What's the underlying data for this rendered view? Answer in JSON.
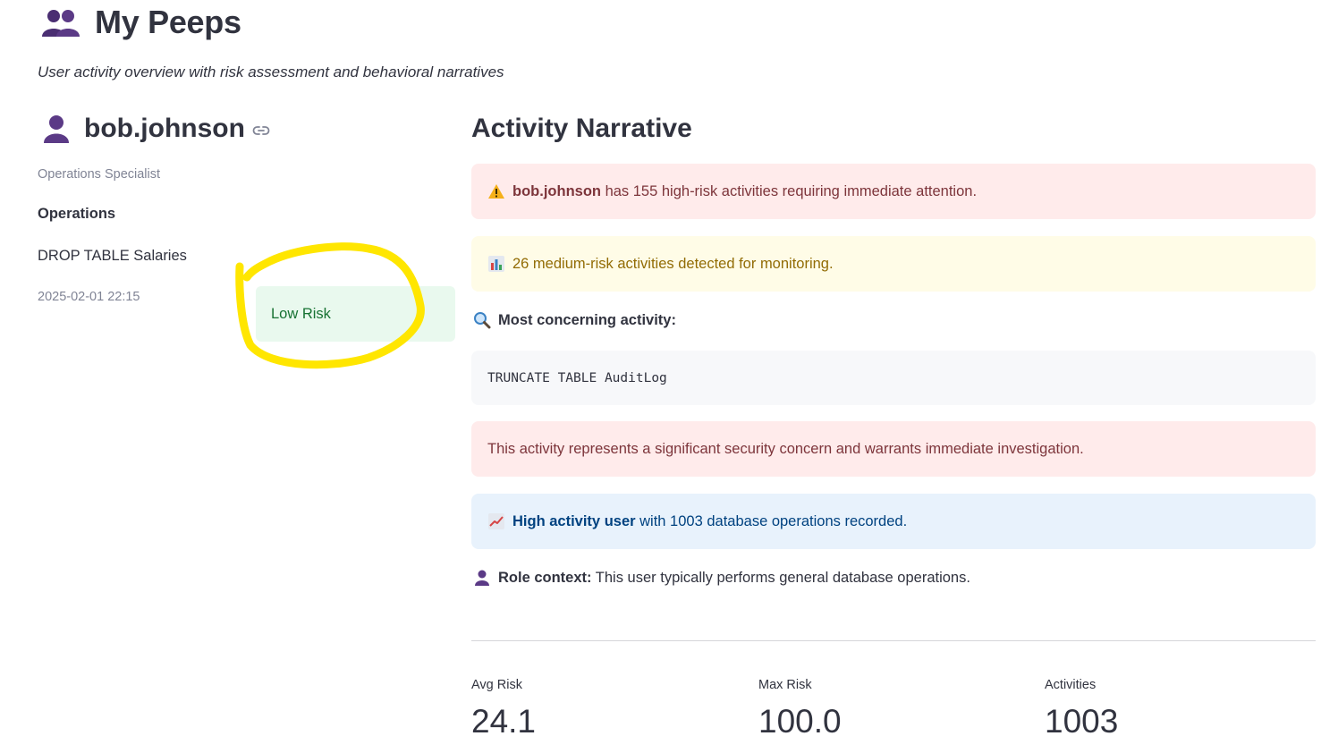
{
  "header": {
    "title": "My Peeps",
    "subtitle": "User activity overview with risk assessment and behavioral narratives",
    "icon": "busts-in-silhouette-icon"
  },
  "user": {
    "name": "bob.johnson",
    "role": "Operations Specialist",
    "department": "Operations",
    "activity": "DROP TABLE Salaries",
    "timestamp": "2025-02-01 22:15",
    "risk_badge": "Low Risk"
  },
  "narrative": {
    "title": "Activity Narrative",
    "high_risk_user": "bob.johnson",
    "high_risk_text": " has 155 high-risk activities requiring immediate attention.",
    "medium_risk_text": "26 medium-risk activities detected for monitoring.",
    "most_concerning_label": "Most concerning activity:",
    "most_concerning_query": "TRUNCATE TABLE AuditLog",
    "concern_text": "This activity represents a significant security concern and warrants immediate investigation.",
    "activity_level_bold": "High activity user",
    "activity_level_text": " with 1003 database operations recorded.",
    "role_context_label": "Role context:",
    "role_context_text": " This user typically performs general database operations."
  },
  "metrics": [
    {
      "label": "Avg Risk",
      "value": "24.1"
    },
    {
      "label": "Max Risk",
      "value": "100.0"
    },
    {
      "label": "Activities",
      "value": "1003"
    }
  ],
  "colors": {
    "error_bg": "#ffebeb",
    "warning_bg": "#fffce7",
    "info_bg": "#e8f2fc",
    "success_bg": "#e9f9ee",
    "highlight": "#ffe600",
    "icon_purple": "#5b3a86"
  }
}
